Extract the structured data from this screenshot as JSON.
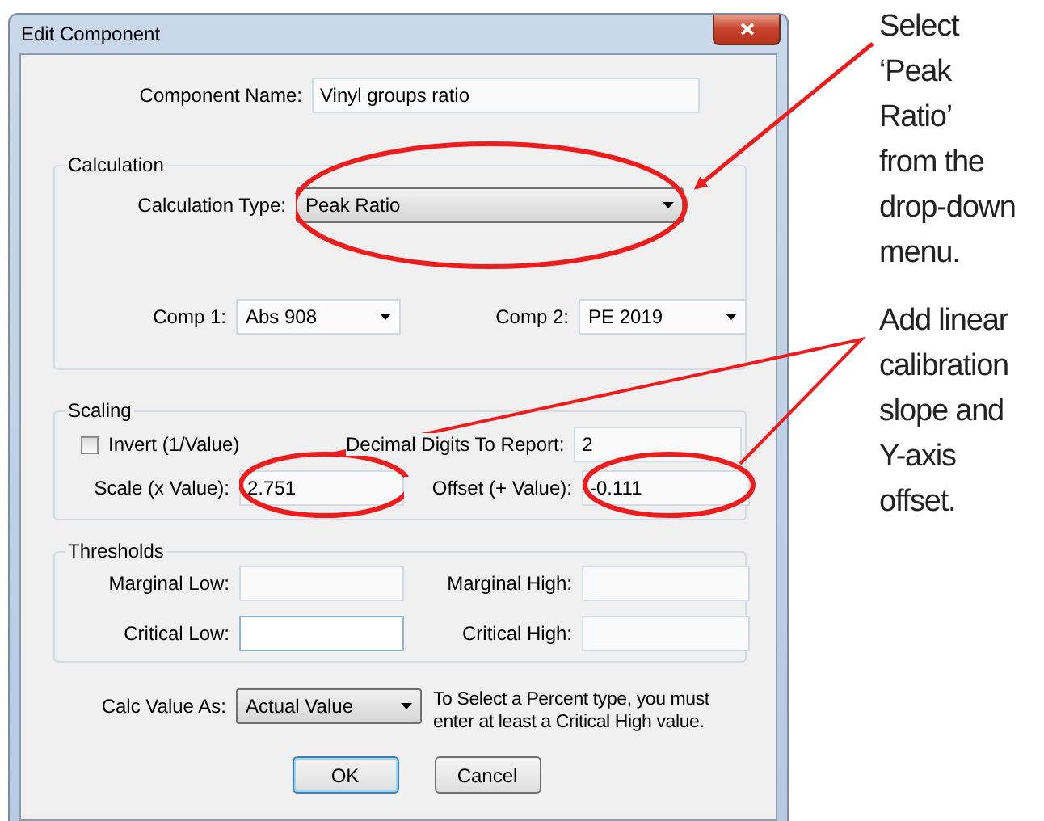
{
  "window": {
    "title": "Edit Component"
  },
  "component_name": {
    "label": "Component Name:",
    "value": "Vinyl groups ratio"
  },
  "calculation": {
    "legend": "Calculation",
    "type": {
      "label": "Calculation Type:",
      "value": "Peak Ratio"
    },
    "comp1": {
      "label": "Comp 1:",
      "value": "Abs 908"
    },
    "comp2": {
      "label": "Comp 2:",
      "value": "PE 2019"
    }
  },
  "scaling": {
    "legend": "Scaling",
    "invert": {
      "label": "Invert (1/Value)",
      "checked": false
    },
    "decimal_digits": {
      "label": "Decimal Digits To Report:",
      "value": "2"
    },
    "scale": {
      "label": "Scale (x Value):",
      "value": "2.751"
    },
    "offset": {
      "label": "Offset (+ Value):",
      "value": "-0.111"
    }
  },
  "thresholds": {
    "legend": "Thresholds",
    "fields": [
      {
        "label": "Marginal Low:",
        "focused": false
      },
      {
        "label": "Marginal High:",
        "focused": false
      },
      {
        "label": "Critical Low:",
        "focused": true
      },
      {
        "label": "Critical High:",
        "focused": false
      }
    ]
  },
  "calc_value_as": {
    "label": "Calc Value As:",
    "value": "Actual Value",
    "note": "To Select a Percent type, you must enter at least a Critical High value."
  },
  "buttons": [
    {
      "label": "OK",
      "default": true
    },
    {
      "label": "Cancel",
      "default": false
    }
  ],
  "callouts": [
    {
      "text": "Select\n‘Peak\nRatio’\nfrom the\ndrop-down\nmenu."
    },
    {
      "text": "Add linear\ncalibration\nslope and\nY-axis\noffset."
    }
  ]
}
